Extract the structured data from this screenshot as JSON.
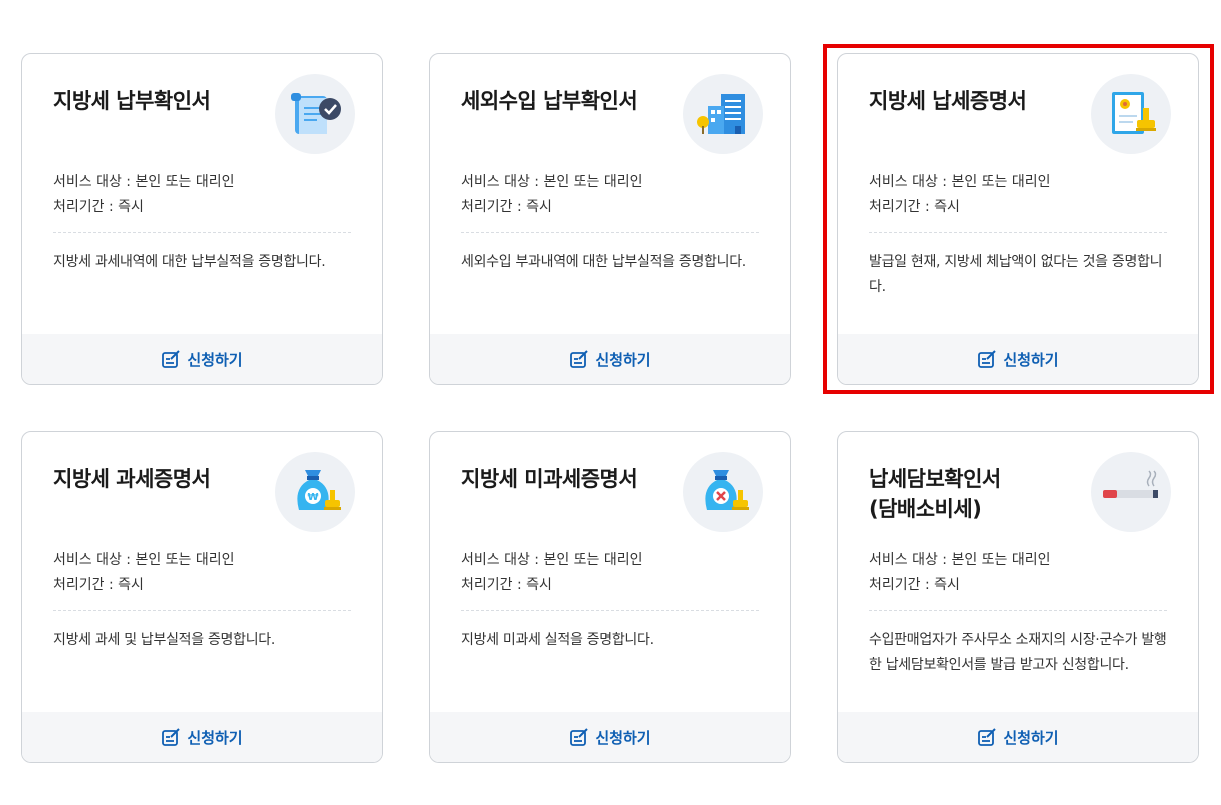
{
  "common": {
    "service_target": "서비스 대상 : 본인 또는 대리인",
    "processing_period": "처리기간 : 즉시",
    "apply_label": "신청하기"
  },
  "colors": {
    "accent": "#0f5fb3",
    "highlight": "#e60000",
    "icon_bg": "#eef1f5"
  },
  "cards": [
    {
      "title": "지방세 납부확인서",
      "icon": "scroll-check-icon",
      "description": "지방세 과세내역에 대한 납부실적을 증명합니다."
    },
    {
      "title": "세외수입 납부확인서",
      "icon": "building-document-icon",
      "description": "세외수입 부과내역에 대한 납부실적을 증명합니다."
    },
    {
      "title": "지방세 납세증명서",
      "icon": "certificate-stamp-icon",
      "description": "발급일 현재, 지방세 체납액이 없다는 것을 증명합니다.",
      "highlighted": true
    },
    {
      "title": "지방세 과세증명서",
      "icon": "money-bag-stamp-icon",
      "description": "지방세 과세 및 납부실적을 증명합니다."
    },
    {
      "title": "지방세 미과세증명서",
      "icon": "money-bag-x-icon",
      "description": "지방세 미과세 실적을 증명합니다."
    },
    {
      "title_line1": "납세담보확인서",
      "title_line2": "(담배소비세)",
      "icon": "cigarette-icon",
      "description": "수입판매업자가 주사무소 소재지의 시장·군수가 발행한 납세담보확인서를 발급 받고자 신청합니다."
    }
  ]
}
